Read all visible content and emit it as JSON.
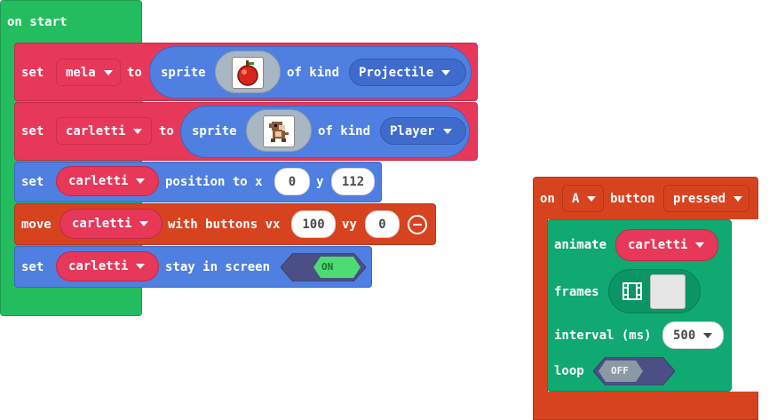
{
  "colors": {
    "events_green": "#23bd5f",
    "sprites_red": "#e7385a",
    "sprites_blue": "#4f7fe0",
    "controller_orange": "#d8431f",
    "animation_teal": "#0fa971",
    "toggle_on": "#4ddb73",
    "toggle_off": "#8a9aa4",
    "toggle_track": "#4b4f86"
  },
  "on_start": {
    "label": "on start",
    "blocks": {
      "set_mela": {
        "set": "set",
        "variable": "mela",
        "to": "to",
        "sprite": "sprite",
        "of_kind": "of kind",
        "kind": "Projectile",
        "image": "apple"
      },
      "set_carletti": {
        "set": "set",
        "variable": "carletti",
        "to": "to",
        "sprite": "sprite",
        "of_kind": "of kind",
        "kind": "Player",
        "image": "monkey"
      },
      "position": {
        "set": "set",
        "variable": "carletti",
        "text": "position to x",
        "x": "0",
        "y_label": "y",
        "y": "112"
      },
      "move": {
        "move": "move",
        "variable": "carletti",
        "text": "with buttons vx",
        "vx": "100",
        "vy_label": "vy",
        "vy": "0"
      },
      "stay": {
        "set": "set",
        "variable": "carletti",
        "text": "stay in screen",
        "toggle": "ON"
      }
    }
  },
  "on_button": {
    "on": "on",
    "button": "A",
    "button_label": "button",
    "event": "pressed",
    "animate": {
      "animate": "animate",
      "variable": "carletti",
      "frames": "frames",
      "interval_label": "interval (ms)",
      "interval": "500",
      "loop": "loop",
      "loop_toggle": "OFF"
    }
  }
}
